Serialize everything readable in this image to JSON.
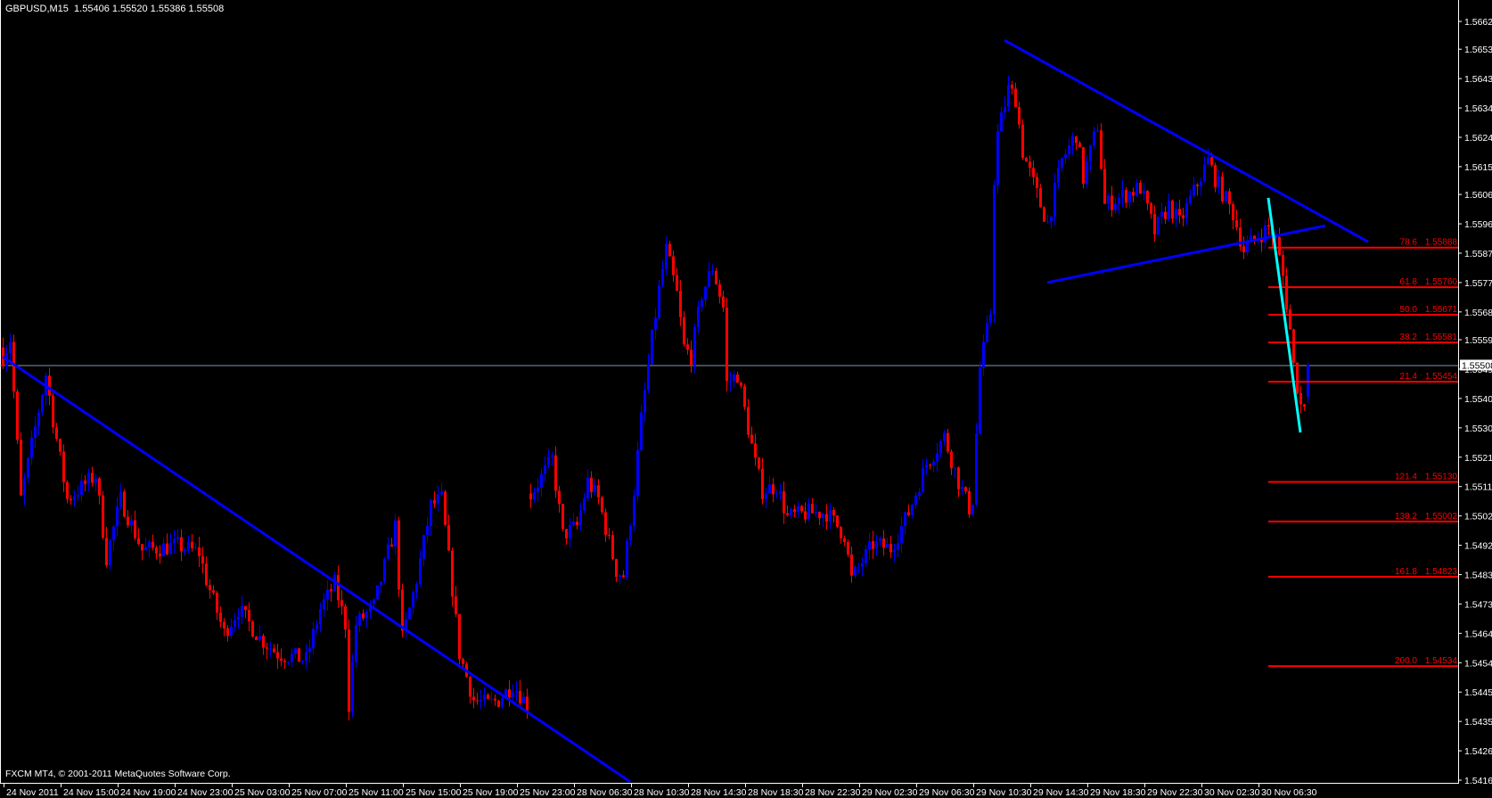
{
  "header": {
    "symbol_timeframe": "GBPUSD,M15",
    "ohlc_text": "1.55406 1.55520 1.55386 1.55508"
  },
  "footer": {
    "copyright": "FXCM MT4, © 2001-2011 MetaQuotes Software Corp."
  },
  "colors": {
    "background": "#000000",
    "bull": "#0000ff",
    "bear": "#ff0000",
    "trendline": "#0000ff",
    "impulse_line": "#00ffff",
    "fibo": "#ff0000",
    "bid_line": "#8899aa",
    "axis": "#ffffff"
  },
  "chart_data": {
    "type": "candlestick",
    "symbol": "GBPUSD",
    "timeframe": "M15",
    "ylim": [
      1.54165,
      1.5662
    ],
    "last_bar": {
      "open": 1.55406,
      "high": 1.5552,
      "low": 1.55386,
      "close": 1.55508
    },
    "bid": "1.55508",
    "bar_count": 367,
    "close_path_waypoints": [
      [
        0,
        1.55535
      ],
      [
        2,
        1.55593
      ],
      [
        5,
        1.55074
      ],
      [
        8,
        1.55247
      ],
      [
        12,
        1.55478
      ],
      [
        14,
        1.55333
      ],
      [
        18,
        1.55074
      ],
      [
        26,
        1.55152
      ],
      [
        29,
        1.54886
      ],
      [
        33,
        1.55074
      ],
      [
        39,
        1.54909
      ],
      [
        49,
        1.54924
      ],
      [
        55,
        1.54901
      ],
      [
        57,
        1.54814
      ],
      [
        62,
        1.54641
      ],
      [
        66,
        1.54719
      ],
      [
        72,
        1.54626
      ],
      [
        77,
        1.54575
      ],
      [
        85,
        1.54554
      ],
      [
        89,
        1.54719
      ],
      [
        93,
        1.548
      ],
      [
        96,
        1.5467
      ],
      [
        97,
        1.5441
      ],
      [
        99,
        1.5467
      ],
      [
        104,
        1.54727
      ],
      [
        110,
        1.54987
      ],
      [
        112,
        1.54621
      ],
      [
        116,
        1.54814
      ],
      [
        120,
        1.55053
      ],
      [
        123,
        1.55074
      ],
      [
        126,
        1.54785
      ],
      [
        128,
        1.54575
      ],
      [
        132,
        1.54425
      ],
      [
        136,
        1.5441
      ],
      [
        139,
        1.54425
      ],
      [
        143,
        1.54476
      ],
      [
        147,
        1.5441
      ],
      [
        148,
        1.55088
      ],
      [
        154,
        1.55203
      ],
      [
        157,
        1.54958
      ],
      [
        161,
        1.54987
      ],
      [
        164,
        1.55131
      ],
      [
        167,
        1.55074
      ],
      [
        172,
        1.54843
      ],
      [
        174,
        1.54828
      ],
      [
        177,
        1.55102
      ],
      [
        179,
        1.55333
      ],
      [
        182,
        1.55593
      ],
      [
        184,
        1.55752
      ],
      [
        186,
        1.55881
      ],
      [
        189,
        1.55737
      ],
      [
        191,
        1.55564
      ],
      [
        193,
        1.55535
      ],
      [
        196,
        1.55737
      ],
      [
        199,
        1.55824
      ],
      [
        202,
        1.55694
      ],
      [
        203,
        1.55449
      ],
      [
        206,
        1.55478
      ],
      [
        208,
        1.55362
      ],
      [
        211,
        1.55189
      ],
      [
        213,
        1.55102
      ],
      [
        217,
        1.55117
      ],
      [
        220,
        1.55016
      ],
      [
        226,
        1.5503
      ],
      [
        231,
        1.5503
      ],
      [
        236,
        1.54958
      ],
      [
        238,
        1.54814
      ],
      [
        241,
        1.54872
      ],
      [
        244,
        1.54929
      ],
      [
        249,
        1.54915
      ],
      [
        254,
        1.5503
      ],
      [
        259,
        1.55189
      ],
      [
        264,
        1.55276
      ],
      [
        268,
        1.55131
      ],
      [
        271,
        1.55045
      ],
      [
        272,
        1.55074
      ],
      [
        274,
        1.55498
      ],
      [
        277,
        1.55679
      ],
      [
        278,
        1.56112
      ],
      [
        279,
        1.56256
      ],
      [
        282,
        1.56401
      ],
      [
        284,
        1.56372
      ],
      [
        286,
        1.56199
      ],
      [
        291,
        1.56026
      ],
      [
        293,
        1.55968
      ],
      [
        297,
        1.5617
      ],
      [
        301,
        1.56256
      ],
      [
        303,
        1.56112
      ],
      [
        307,
        1.56285
      ],
      [
        309,
        1.56026
      ],
      [
        314,
        1.56055
      ],
      [
        319,
        1.56083
      ],
      [
        323,
        1.55939
      ],
      [
        327,
        1.56026
      ],
      [
        330,
        1.55968
      ],
      [
        338,
        1.5617
      ],
      [
        340,
        1.56112
      ],
      [
        345,
        1.55997
      ],
      [
        348,
        1.55881
      ],
      [
        352,
        1.55925
      ],
      [
        355,
        1.55954
      ],
      [
        357,
        1.5591
      ],
      [
        359,
        1.55795
      ],
      [
        361,
        1.55622
      ],
      [
        362,
        1.55506
      ],
      [
        364,
        1.55377
      ],
      [
        365,
        1.55391
      ],
      [
        366,
        1.55508
      ]
    ],
    "price_ticks": [
      "1.56620",
      "1.56530",
      "1.56435",
      "1.56340",
      "1.56245",
      "1.56150",
      "1.56060",
      "1.55965",
      "1.55870",
      "1.55775",
      "1.55680",
      "1.55590",
      "1.55495",
      "1.55400",
      "1.55305",
      "1.55210",
      "1.55115",
      "1.55020",
      "1.54925",
      "1.54830",
      "1.54735",
      "1.54640",
      "1.54545",
      "1.54450",
      "1.54355",
      "1.54260",
      "1.54165"
    ],
    "time_ticks": [
      "24 Nov 2011",
      "24 Nov 15:00",
      "24 Nov 19:00",
      "24 Nov 23:00",
      "25 Nov 03:00",
      "25 Nov 07:00",
      "25 Nov 11:00",
      "25 Nov 15:00",
      "25 Nov 19:00",
      "25 Nov 23:00",
      "28 Nov 06:30",
      "28 Nov 10:30",
      "28 Nov 14:30",
      "28 Nov 18:30",
      "28 Nov 22:30",
      "29 Nov 02:30",
      "29 Nov 06:30",
      "29 Nov 10:30",
      "29 Nov 14:30",
      "29 Nov 18:30",
      "29 Nov 22:30",
      "30 Nov 02:30",
      "30 Nov 06:30"
    ],
    "bars_per_time_tick": 16,
    "trendlines": [
      {
        "name": "downtrend-line",
        "color": "#0000ff",
        "from": [
          0,
          1.55535
        ],
        "to": [
          176,
          1.5416
        ]
      },
      {
        "name": "triangle-upper-line",
        "color": "#0000ff",
        "from": [
          281,
          1.56559
        ],
        "to": [
          383,
          1.55907
        ]
      },
      {
        "name": "triangle-lower-line",
        "color": "#0000ff",
        "from": [
          293,
          1.55775
        ],
        "to": [
          371,
          1.55959
        ]
      },
      {
        "name": "impulse-line",
        "color": "#00ffff",
        "from": [
          355,
          1.56049
        ],
        "to": [
          364,
          1.5529
        ]
      }
    ],
    "fibo_start_bar": 355,
    "fibo_levels": [
      {
        "level": "78.6",
        "price": "1.55888"
      },
      {
        "level": "61.8",
        "price": "1.55760"
      },
      {
        "level": "50.0",
        "price": "1.55671"
      },
      {
        "level": "38.2",
        "price": "1.55581"
      },
      {
        "level": "21.4",
        "price": "1.55454"
      },
      {
        "level": "121.4",
        "price": "1.55130"
      },
      {
        "level": "138.2",
        "price": "1.55002"
      },
      {
        "level": "161.8",
        "price": "1.54823"
      },
      {
        "level": "200.0",
        "price": "1.54534"
      }
    ]
  }
}
